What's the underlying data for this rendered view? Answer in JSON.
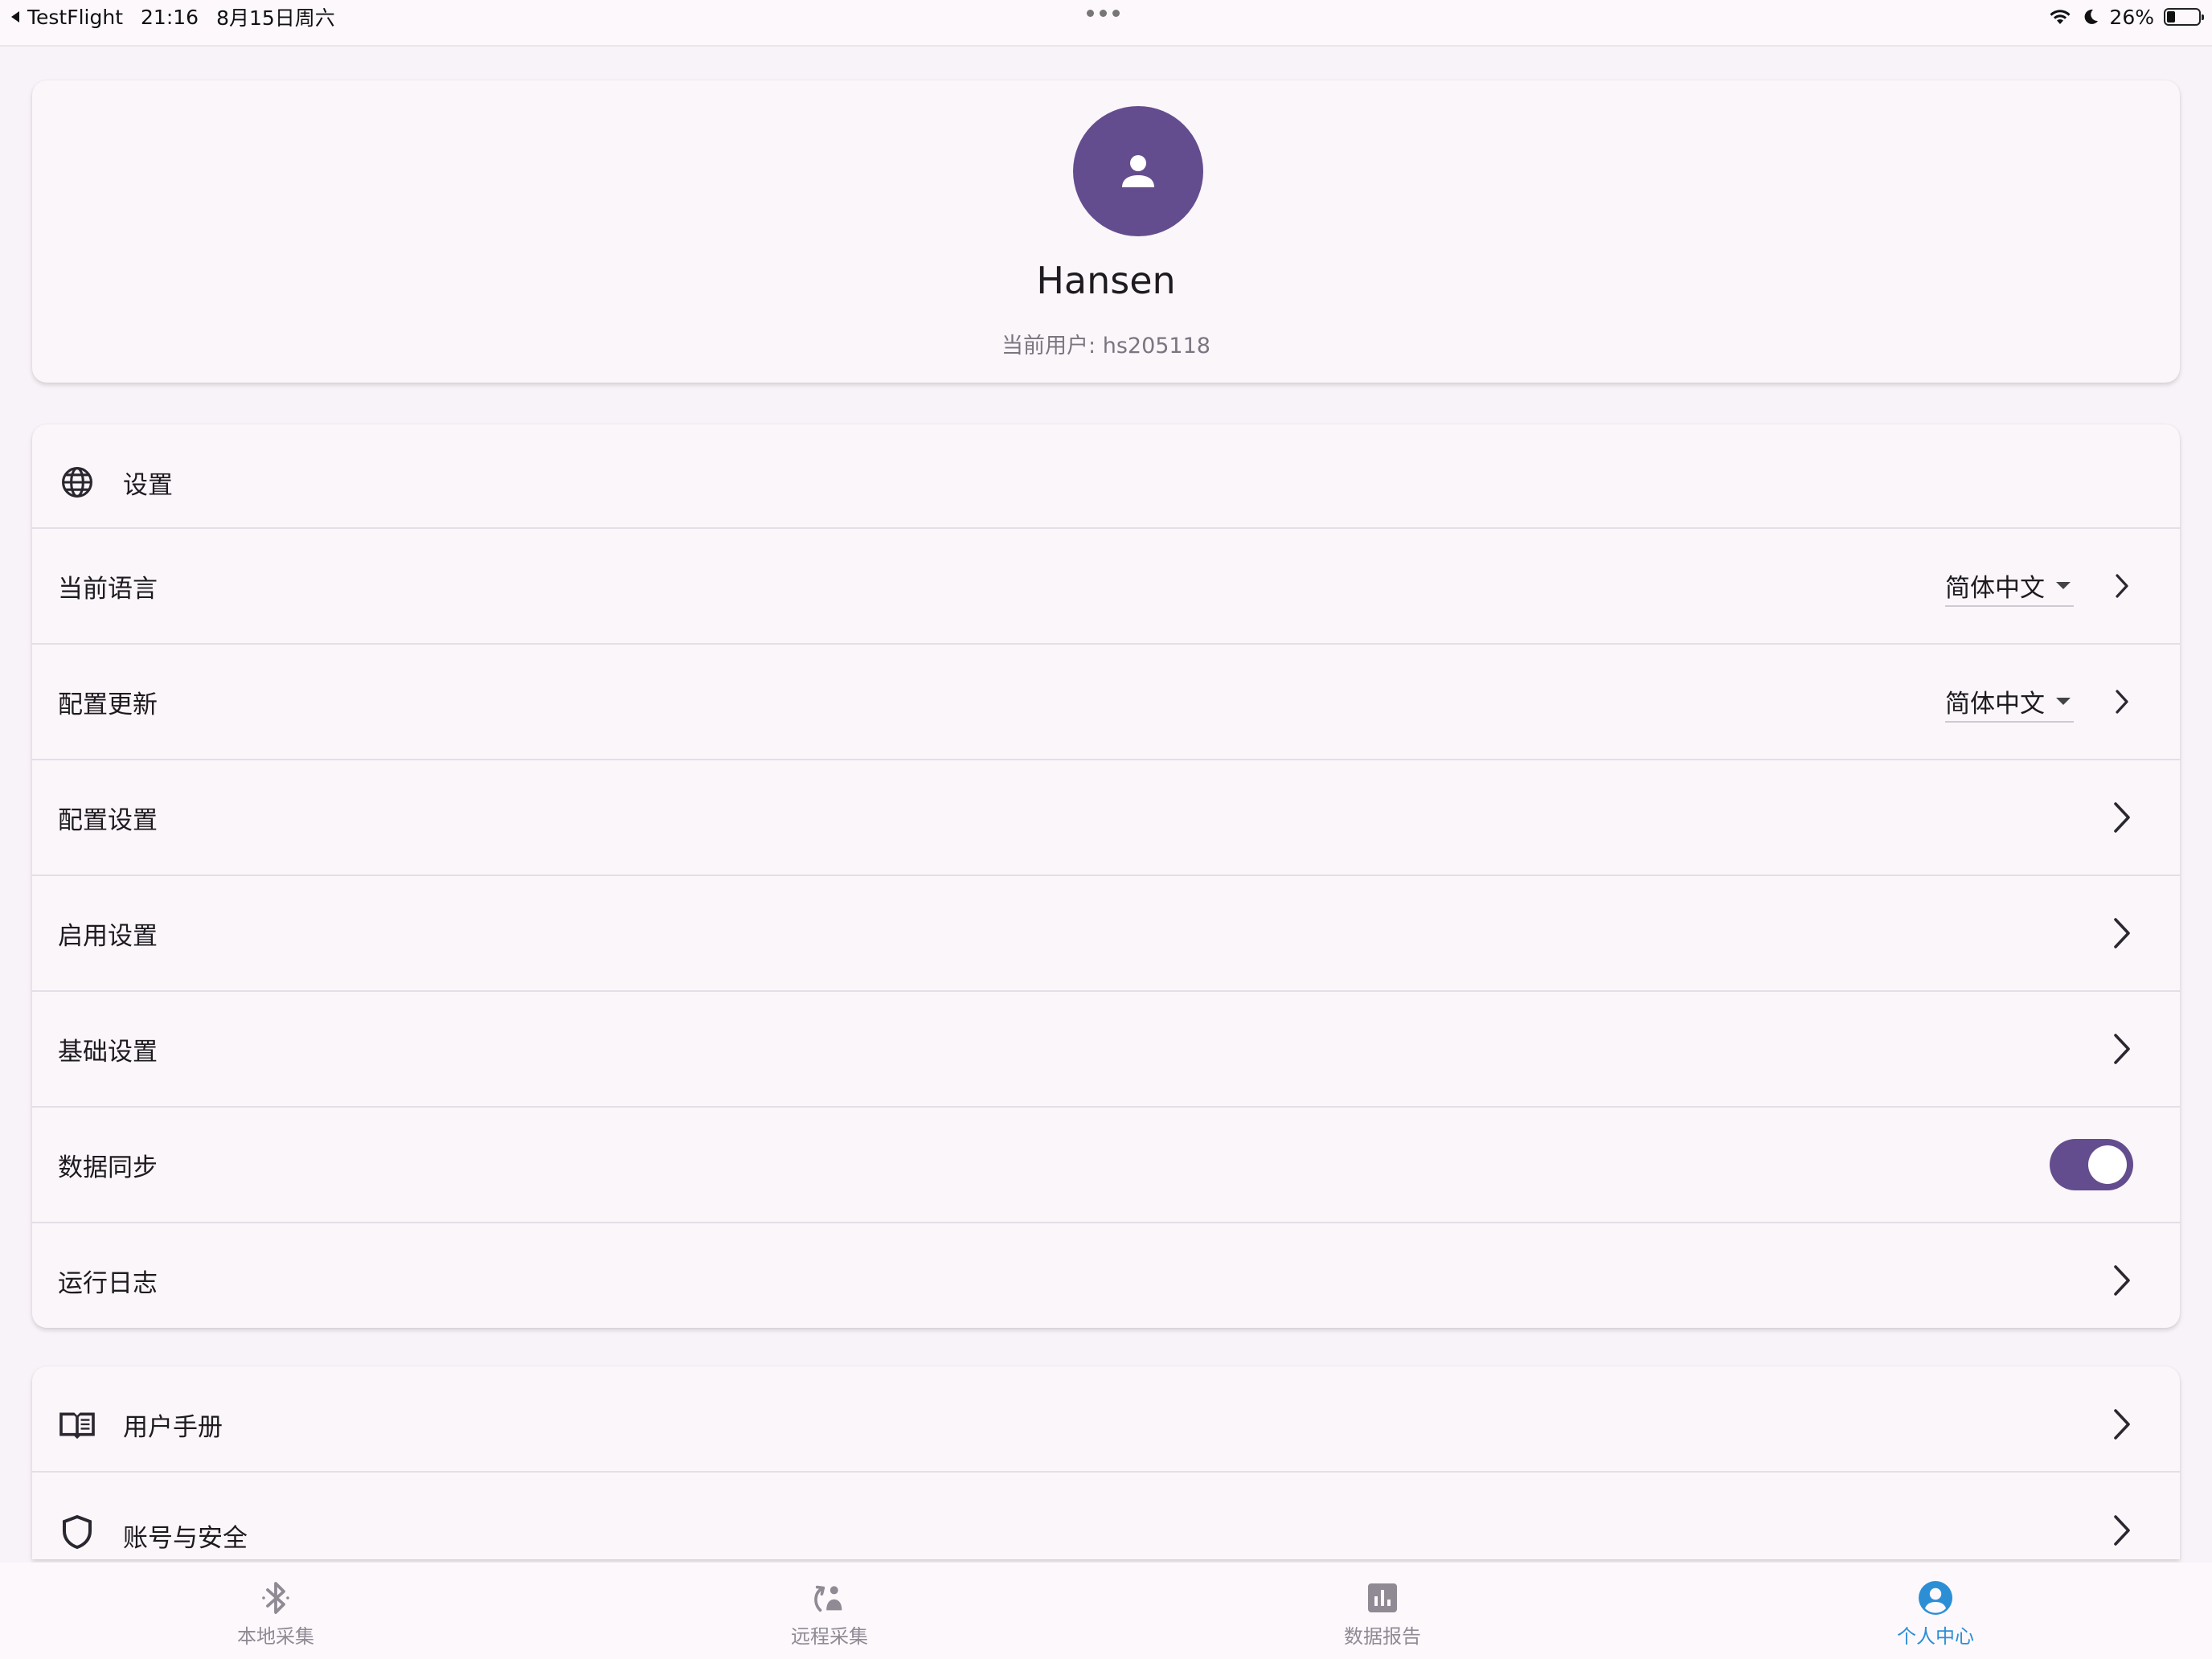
{
  "status_bar": {
    "back_app": "TestFlight",
    "time": "21:16",
    "date": "8月15日周六",
    "battery": "26%",
    "battery_level": 0.26
  },
  "profile": {
    "name": "Hansen",
    "current_user": "当前用户: hs205118"
  },
  "settings": {
    "header": "设置",
    "rows": [
      {
        "label": "当前语言",
        "value": "简体中文"
      },
      {
        "label": "配置更新",
        "value": "简体中文"
      },
      {
        "label": "配置设置"
      },
      {
        "label": "启用设置"
      },
      {
        "label": "基础设置"
      },
      {
        "label": "数据同步",
        "toggle_on": true
      },
      {
        "label": "运行日志"
      }
    ]
  },
  "more": {
    "rows": [
      {
        "label": "用户手册"
      },
      {
        "label": "账号与安全"
      }
    ]
  },
  "nav": {
    "items": [
      {
        "label": "本地采集"
      },
      {
        "label": "远程采集"
      },
      {
        "label": "数据报告"
      },
      {
        "label": "个人中心"
      }
    ],
    "active": "个人中心"
  },
  "colors": {
    "accent": "#644d8e",
    "active_nav": "#2c8fd6",
    "background": "#f8f3f8"
  }
}
